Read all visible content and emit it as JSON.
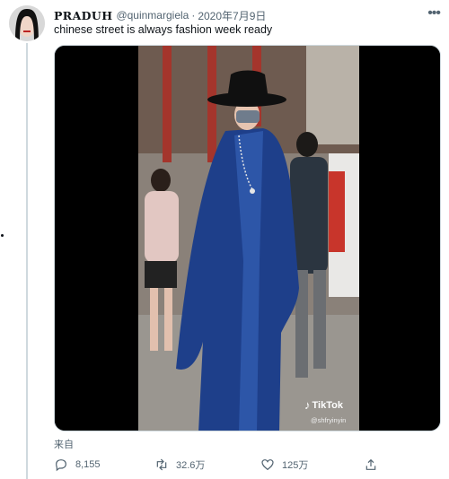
{
  "tweet": {
    "display_name": "PRADUH",
    "handle": "@quinmargiela",
    "separator": "·",
    "date": "2020年7月9日",
    "text": "chinese street is always fashion week ready",
    "more_icon": "more-horizontal-icon"
  },
  "media": {
    "watermark_brand": "TikTok",
    "watermark_user": "@shfryinyin",
    "colors": {
      "robe": "#1e3f8a",
      "hat": "#101010",
      "letterbox": "#000000"
    }
  },
  "source_label": "来自",
  "actions": {
    "reply_count": "8,155",
    "retweet_count": "32.6万",
    "like_count": "125万",
    "icons": [
      "reply-icon",
      "retweet-icon",
      "like-icon",
      "share-icon"
    ]
  }
}
